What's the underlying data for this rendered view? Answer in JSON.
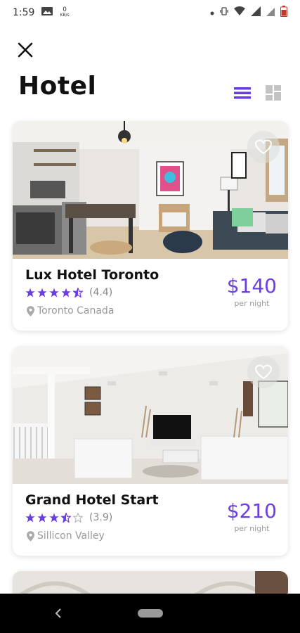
{
  "status_bar": {
    "time": "1:59",
    "speed": "0",
    "speed_unit": "KB/s"
  },
  "header": {
    "title": "Hotel"
  },
  "colors": {
    "accent": "#6a3de8",
    "star": "#6a3de8"
  },
  "hotels": [
    {
      "name": "Lux Hotel Toronto",
      "rating_text": "(4.4)",
      "rating_value": 4.4,
      "location": "Toronto Canada",
      "price": "$140",
      "price_unit": "per night"
    },
    {
      "name": "Grand Hotel Start",
      "rating_text": "(3.9)",
      "rating_value": 3.9,
      "location": "Sillicon Valley",
      "price": "$210",
      "price_unit": "per night"
    }
  ],
  "icons": {
    "close": "close-icon",
    "list": "list-view-icon",
    "grid": "grid-view-icon",
    "heart": "heart-icon",
    "pin": "location-pin-icon",
    "star": "star-icon"
  }
}
